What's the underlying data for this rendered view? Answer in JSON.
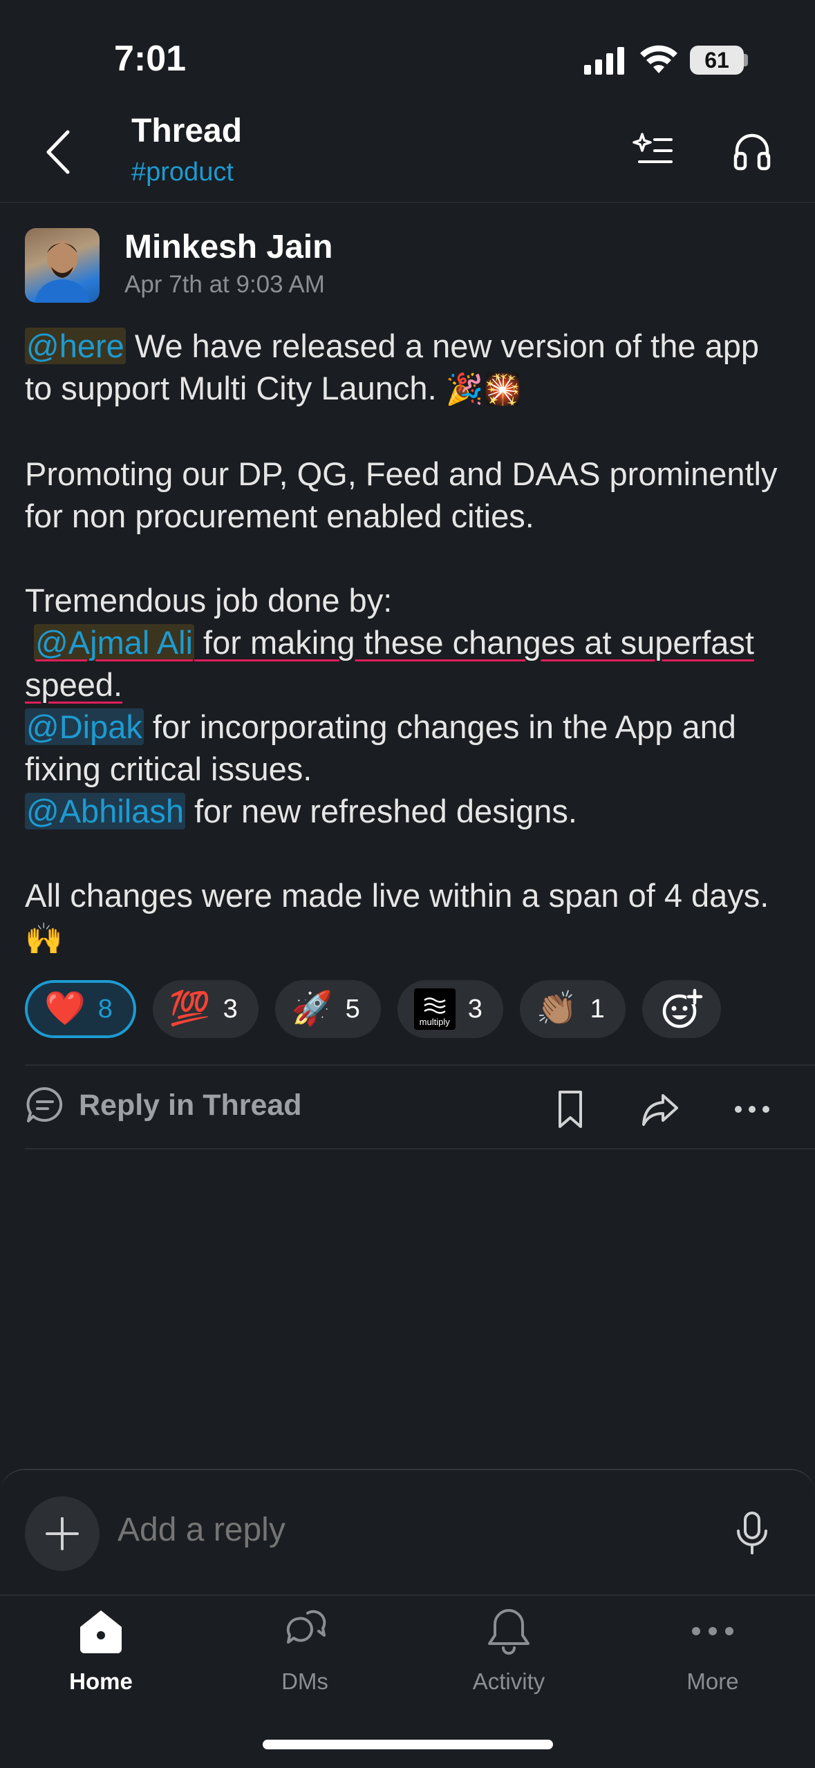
{
  "status_bar": {
    "time": "7:01",
    "battery": "61"
  },
  "header": {
    "title": "Thread",
    "channel": "#product"
  },
  "message": {
    "author": "Minkesh Jain",
    "timestamp": "Apr 7th at 9:03 AM",
    "mention_here": "@here",
    "line1_text": " We have released a new version of the app to support Multi City Launch.",
    "line1_emoji": "🎉🎇",
    "para2": "Promoting our DP, QG, Feed and DAAS prominently for non procurement enabled cities.",
    "para3_intro": "Tremendous job done by:",
    "mention_ajmal": "@Ajmal Ali",
    "ajmal_text": " for making these changes at superfast speed.",
    "mention_dipak": "@Dipak",
    "dipak_text": " for incorporating changes in the App and fixing critical issues.",
    "mention_abhilash": "@Abhilash",
    "abhilash_text": " for new refreshed designs.",
    "para4": "All changes were made live within a span of 4 days.",
    "para4_emoji": "🙌"
  },
  "reactions": [
    {
      "emoji": "❤️",
      "count": "8",
      "active": true
    },
    {
      "emoji": "💯",
      "count": "3"
    },
    {
      "emoji": "🚀",
      "count": "5"
    },
    {
      "emoji": "multiply",
      "count": "3"
    },
    {
      "emoji": "👏🏽",
      "count": "1"
    }
  ],
  "actions": {
    "reply_in_thread": "Reply in Thread"
  },
  "composer": {
    "placeholder": "Add a reply"
  },
  "tabs": [
    {
      "label": "Home"
    },
    {
      "label": "DMs"
    },
    {
      "label": "Activity"
    },
    {
      "label": "More"
    }
  ],
  "colors": {
    "background": "#1a1d21",
    "accent": "#1d9bd1",
    "mention_bg": "#1f3a4d"
  }
}
